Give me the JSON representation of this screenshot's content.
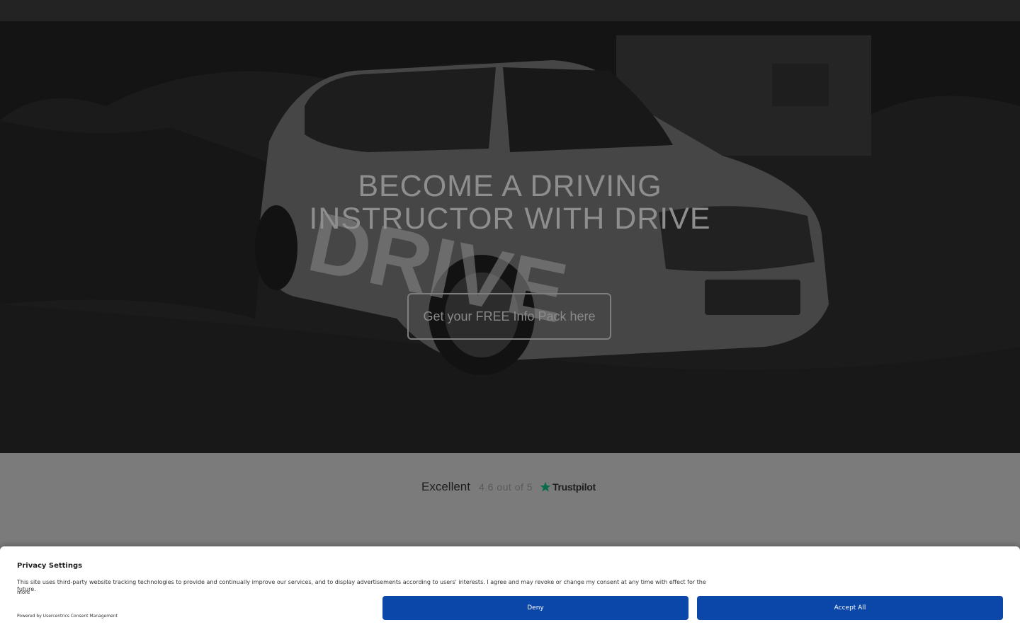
{
  "hero": {
    "title_line1": "BECOME A DRIVING",
    "title_line2": "INSTRUCTOR WITH DRIVE",
    "cta_label": "Get your FREE Info Pack here",
    "car_decal_text": "DRIVE"
  },
  "trustpilot": {
    "rating_word": "Excellent",
    "score_text": "4.6 out of 5",
    "brand": "Trustpilot",
    "star_color": "#00b67a"
  },
  "consent": {
    "title": "Privacy Settings",
    "text": "This site uses third-party website tracking technologies to provide and continually improve our services, and to display advertisements according to users' interests. I agree and may revoke or change my consent at any time with effect for the future.",
    "more_link": "more",
    "powered_by": "Powered by Usercentrics Consent Management",
    "deny_label": "Deny",
    "accept_label": "Accept All",
    "button_color": "#0a47a9"
  }
}
